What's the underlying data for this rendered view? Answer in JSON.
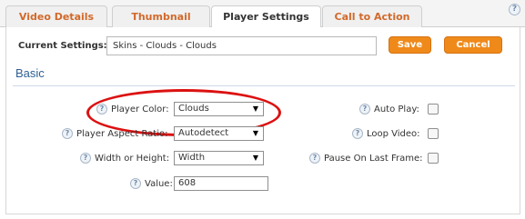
{
  "tabs": [
    {
      "label": "Video Details"
    },
    {
      "label": "Thumbnail"
    },
    {
      "label": "Player Settings",
      "active": true
    },
    {
      "label": "Call to Action"
    }
  ],
  "help_glyph": "?",
  "current_settings": {
    "label": "Current Settings:",
    "value": "Skins - Clouds - Clouds"
  },
  "buttons": {
    "save": "Save",
    "cancel": "Cancel"
  },
  "section": {
    "title": "Basic"
  },
  "left_fields": {
    "player_color": {
      "label": "Player Color:",
      "value": "Clouds"
    },
    "aspect_ratio": {
      "label": "Player Aspect Ratio:",
      "value": "Autodetect"
    },
    "width_or_height": {
      "label": "Width or Height:",
      "value": "Width"
    },
    "value": {
      "label": "Value:",
      "value": "608"
    }
  },
  "right_fields": {
    "auto_play": {
      "label": "Auto Play:",
      "checked": false
    },
    "loop_video": {
      "label": "Loop Video:",
      "checked": false
    },
    "pause_last_frame": {
      "label": "Pause On Last Frame:",
      "checked": false
    }
  },
  "select_arrow": "▼",
  "colors": {
    "tab_text": "#d2692a",
    "button_bg": "#ef8a1a",
    "section_title": "#2f5f93",
    "highlight": "#dc1111"
  }
}
